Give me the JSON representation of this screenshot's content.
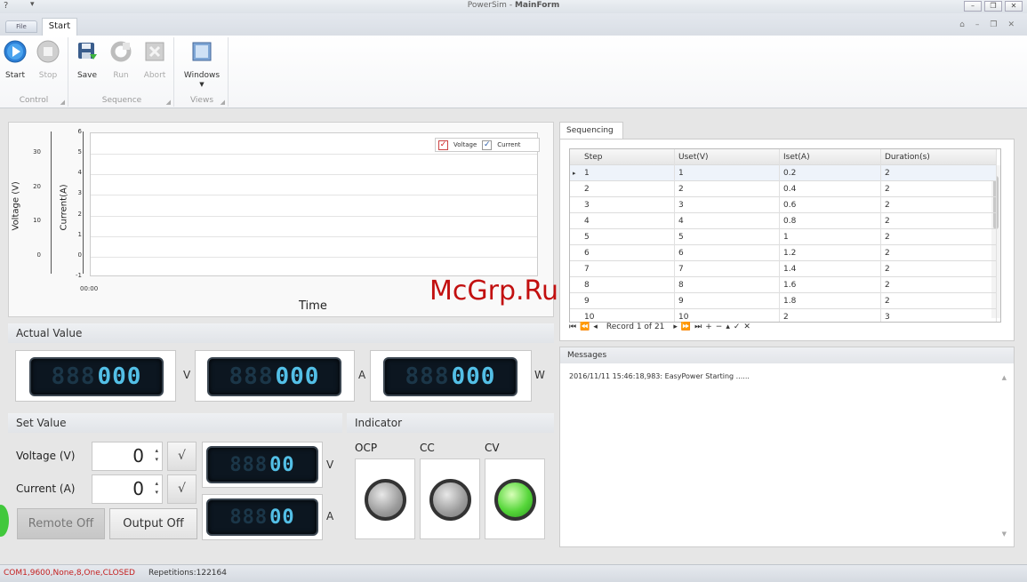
{
  "titlebar": {
    "quick_access": "?",
    "quick_dropdown": "▾",
    "app": "PowerSim",
    "separator": " - ",
    "form": "MainForm"
  },
  "tabs": {
    "file": "File",
    "start": "Start"
  },
  "ribbon": {
    "buttons": {
      "start": "Start",
      "stop": "Stop",
      "save": "Save",
      "run": "Run",
      "abort": "Abort",
      "windows": "Windows"
    },
    "groups": {
      "control": "Control",
      "sequence": "Sequence",
      "views": "Views"
    }
  },
  "chart_data": {
    "type": "line",
    "xlabel": "Time",
    "ylabel_left": "Voltage (V)",
    "ylabel_right": "Current(A)",
    "voltage_ticks": [
      "30",
      "20",
      "10",
      "0"
    ],
    "current_ticks": [
      "6",
      "5",
      "4",
      "3",
      "2",
      "1",
      "0",
      "-1"
    ],
    "x_ticks": [
      "00:00"
    ],
    "legend": [
      {
        "name": "Voltage",
        "checked": true,
        "color": "#d01818"
      },
      {
        "name": "Current",
        "checked": true,
        "color": "#2a5caa"
      }
    ],
    "series": []
  },
  "actual_value": {
    "title": "Actual Value",
    "voltage": {
      "digits_off": "888",
      "digits_on": "000",
      "unit": "V"
    },
    "current": {
      "digits_off": "888",
      "digits_on": "000",
      "unit": "A"
    },
    "power": {
      "digits_off": "888",
      "digits_on": "000",
      "unit": "W"
    }
  },
  "set_value": {
    "title": "Set Value",
    "voltage_label": "Voltage (V)",
    "current_label": "Current (A)",
    "voltage_value": "0",
    "current_value": "0",
    "confirm": "√",
    "voltage_display": {
      "digits_off": "888",
      "digits_on": "00",
      "unit": "V"
    },
    "current_display": {
      "digits_off": "888",
      "digits_on": "00",
      "unit": "A"
    },
    "remote_button": "Remote Off",
    "output_button": "Output Off"
  },
  "indicator": {
    "title": "Indicator",
    "items": [
      {
        "label": "OCP",
        "state": "off"
      },
      {
        "label": "CC",
        "state": "off"
      },
      {
        "label": "CV",
        "state": "on"
      }
    ]
  },
  "sequencing": {
    "tab": "Sequencing",
    "columns": [
      "Step",
      "Uset(V)",
      "Iset(A)",
      "Duration(s)"
    ],
    "rows": [
      [
        "1",
        "1",
        "0.2",
        "2"
      ],
      [
        "2",
        "2",
        "0.4",
        "2"
      ],
      [
        "3",
        "3",
        "0.6",
        "2"
      ],
      [
        "4",
        "4",
        "0.8",
        "2"
      ],
      [
        "5",
        "5",
        "1",
        "2"
      ],
      [
        "6",
        "6",
        "1.2",
        "2"
      ],
      [
        "7",
        "7",
        "1.4",
        "2"
      ],
      [
        "8",
        "8",
        "1.6",
        "2"
      ],
      [
        "9",
        "9",
        "1.8",
        "2"
      ],
      [
        "10",
        "10",
        "2",
        "3"
      ]
    ],
    "record_text": "Record 1 of 21"
  },
  "messages": {
    "title": "Messages",
    "lines": [
      "2016/11/11 15:46:18,983: EasyPower Starting ......"
    ]
  },
  "watermark": "McGrp.Ru",
  "status": {
    "connection": "COM1,9600,None,8,One,CLOSED",
    "repetitions": "Repetitions:122164"
  }
}
